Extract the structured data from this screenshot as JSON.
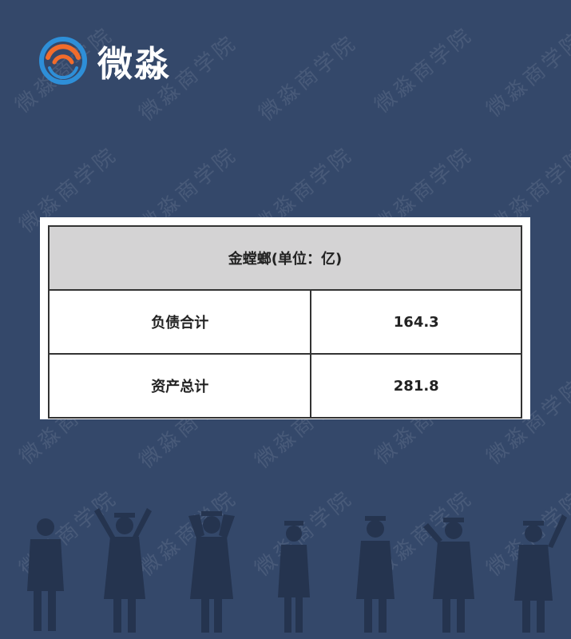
{
  "brand": {
    "name": "微淼",
    "watermark_text": "微淼商学院",
    "colors": {
      "background": "#34486a",
      "logo_orange": "#f26c2b",
      "logo_blue": "#2e8fd8"
    }
  },
  "table": {
    "header": "金螳螂(单位：亿)",
    "rows": [
      {
        "label": "负债合计",
        "value": "164.3"
      },
      {
        "label": "资产总计",
        "value": "281.8"
      }
    ]
  }
}
